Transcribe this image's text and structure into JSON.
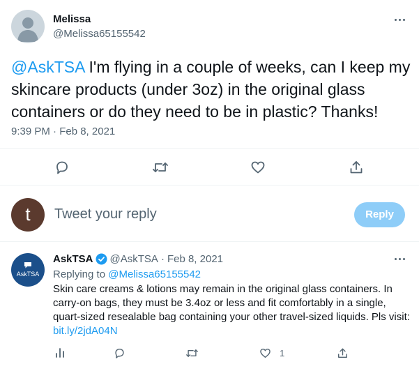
{
  "tweet": {
    "author_name": "Melissa",
    "author_handle": "@Melissa65155542",
    "mention": "@AskTSA",
    "text": " I'm flying in a couple of weeks, can I keep my skincare products (under 3oz) in the original glass containers or do they need to be in plastic? Thanks!",
    "timestamp": "9:39 PM · Feb 8, 2021"
  },
  "composer": {
    "avatar_letter": "t",
    "placeholder": "Tweet your reply",
    "reply_button": "Reply"
  },
  "reply": {
    "avatar_label": "AskTSA",
    "author_name": "AskTSA",
    "author_handle": "@AskTSA",
    "separator": "·",
    "date": "Feb 8, 2021",
    "replying_prefix": "Replying to ",
    "replying_to": "@Melissa65155542",
    "text": "Skin care creams & lotions may remain in the original glass containers. In carry-on bags, they must be 3.4oz or less and fit comfortably in a single, quart-sized resealable bag containing your other travel-sized liquids. Pls visit: ",
    "link": "bit.ly/2jdA04N",
    "like_count": "1"
  },
  "colors": {
    "accent": "#1d9bf0",
    "reply_button_disabled": "#8ecdf8",
    "composer_avatar": "#5b3a2e",
    "tsa_avatar": "#1b4f8a"
  }
}
